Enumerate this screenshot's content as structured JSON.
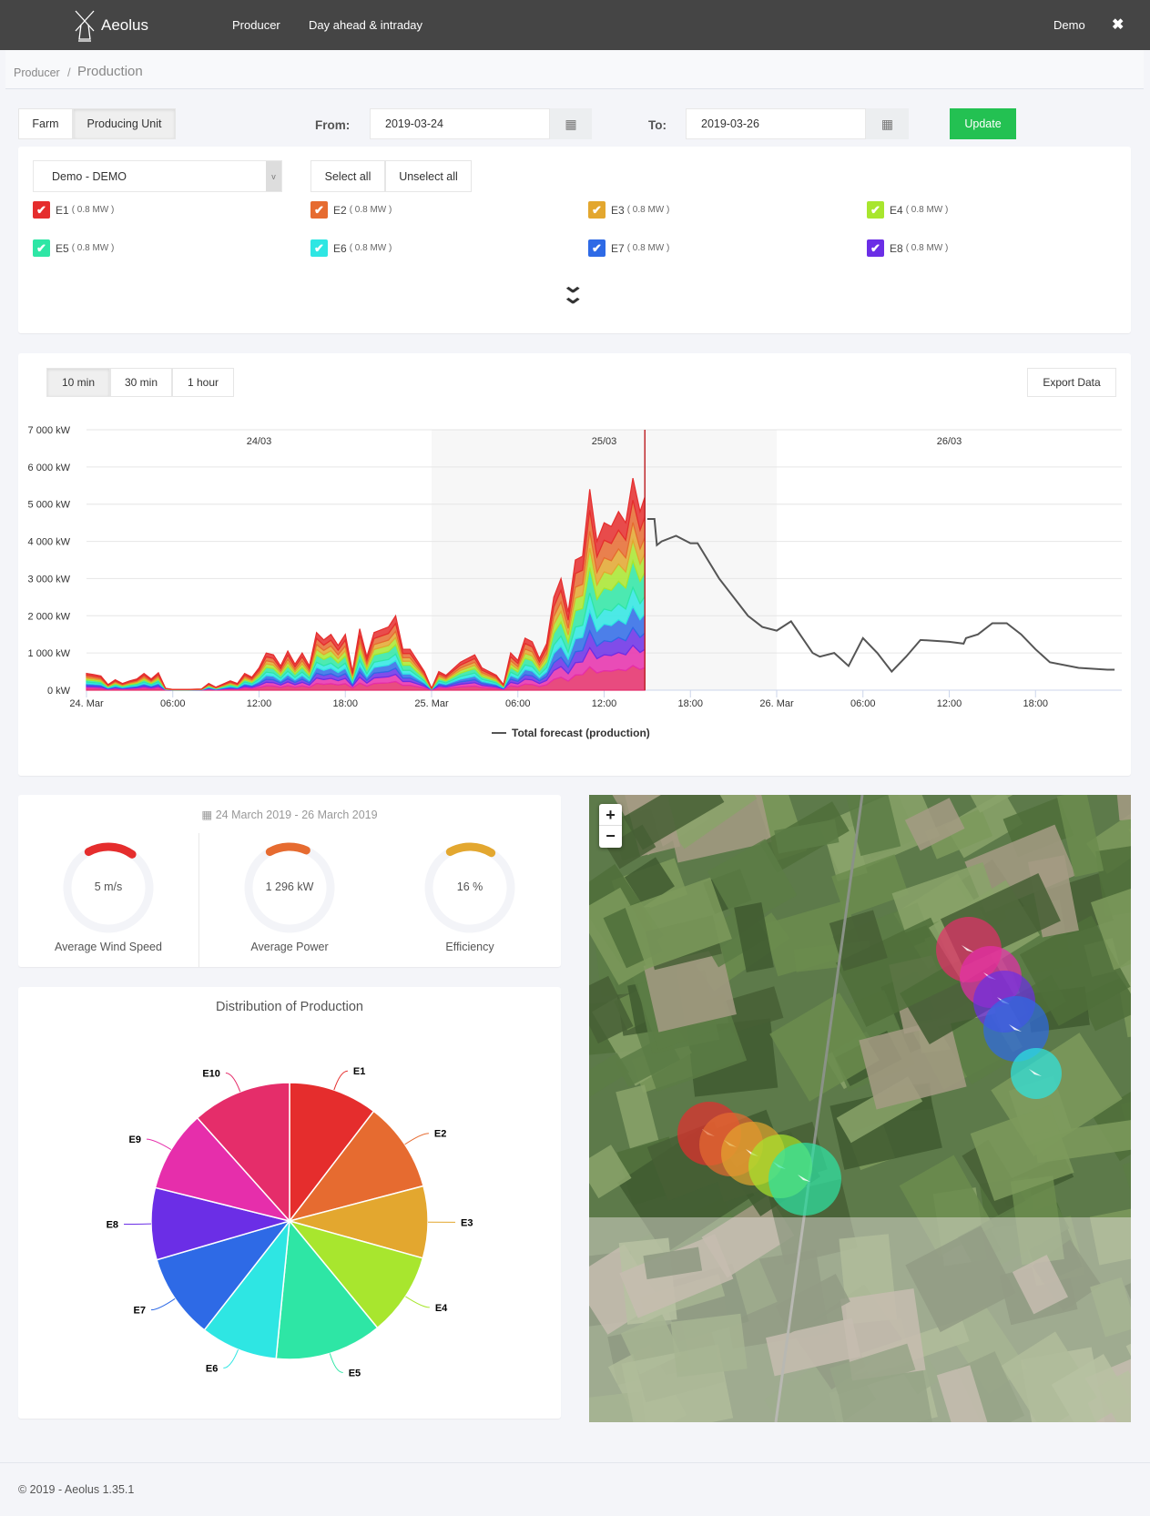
{
  "header": {
    "brand": "Aeolus",
    "nav": [
      "Producer",
      "Day ahead & intraday"
    ],
    "user": "Demo",
    "close_icon": "close-icon"
  },
  "breadcrumb": {
    "parent": "Producer",
    "separator": "/",
    "current": "Production"
  },
  "toolbar": {
    "modes": [
      "Farm",
      "Producing Unit"
    ],
    "active_mode": "Producing Unit",
    "from_label": "From:",
    "from_value": "2019-03-24",
    "to_label": "To:",
    "to_value": "2019-03-26",
    "update_label": "Update"
  },
  "selector": {
    "farm_value": "Demo - DEMO",
    "select_all": "Select all",
    "unselect_all": "Unselect all",
    "units": [
      {
        "name": "E1",
        "cap": "( 0.8 MW )",
        "color": "#e52d2d",
        "checked": true
      },
      {
        "name": "E2",
        "cap": "( 0.8 MW )",
        "color": "#e66b30",
        "checked": true
      },
      {
        "name": "E3",
        "cap": "( 0.8 MW )",
        "color": "#e3a72f",
        "checked": true
      },
      {
        "name": "E4",
        "cap": "( 0.8 MW )",
        "color": "#a8e62e",
        "checked": true
      },
      {
        "name": "E5",
        "cap": "( 0.8 MW )",
        "color": "#2ee6a5",
        "checked": true
      },
      {
        "name": "E6",
        "cap": "( 0.8 MW )",
        "color": "#2ee6e3",
        "checked": true
      },
      {
        "name": "E7",
        "cap": "( 0.8 MW )",
        "color": "#2e6ae6",
        "checked": true
      },
      {
        "name": "E8",
        "cap": "( 0.8 MW )",
        "color": "#6b2ee6",
        "checked": true
      }
    ]
  },
  "chart_controls": {
    "intervals": [
      "10 min",
      "30 min",
      "1 hour"
    ],
    "active": "10 min",
    "export_label": "Export Data"
  },
  "chart_data": [
    {
      "type": "area",
      "stacked": true,
      "yticks": [
        "0 kW",
        "1 000 kW",
        "2 000 kW",
        "3 000 kW",
        "4 000 kW",
        "5 000 kW",
        "6 000 kW",
        "7 000 kW"
      ],
      "ylim": [
        0,
        7000
      ],
      "xticks": [
        "24. Mar",
        "06:00",
        "12:00",
        "18:00",
        "25. Mar",
        "06:00",
        "12:00",
        "18:00",
        "26. Mar",
        "06:00",
        "12:00",
        "18:00"
      ],
      "xlim": [
        "2019-03-24 00:00",
        "2019-03-27 00:00"
      ],
      "day_labels": [
        "24/03",
        "25/03",
        "26/03"
      ],
      "highlighted_day": "2019-03-25",
      "now_marker": "2019-03-25 14:50",
      "grid": true,
      "legend": "bottom",
      "stack_order_bottom_to_top": [
        "E10",
        "E9",
        "E8",
        "E7",
        "E6",
        "E5",
        "E4",
        "E3",
        "E2",
        "E1"
      ],
      "actual_total": [
        [
          "2019-03-24 00:00",
          450
        ],
        [
          "2019-03-24 00:30",
          420
        ],
        [
          "2019-03-24 01:00",
          380
        ],
        [
          "2019-03-24 01:30",
          150
        ],
        [
          "2019-03-24 02:00",
          280
        ],
        [
          "2019-03-24 02:30",
          180
        ],
        [
          "2019-03-24 03:00",
          250
        ],
        [
          "2019-03-24 03:30",
          300
        ],
        [
          "2019-03-24 04:00",
          450
        ],
        [
          "2019-03-24 04:30",
          300
        ],
        [
          "2019-03-24 05:00",
          470
        ],
        [
          "2019-03-24 05:30",
          50
        ],
        [
          "2019-03-24 06:00",
          20
        ],
        [
          "2019-03-24 07:00",
          20
        ],
        [
          "2019-03-24 08:00",
          30
        ],
        [
          "2019-03-24 08:30",
          180
        ],
        [
          "2019-03-24 09:00",
          80
        ],
        [
          "2019-03-24 10:00",
          250
        ],
        [
          "2019-03-24 10:30",
          180
        ],
        [
          "2019-03-24 11:00",
          450
        ],
        [
          "2019-03-24 11:30",
          350
        ],
        [
          "2019-03-24 12:00",
          600
        ],
        [
          "2019-03-24 12:30",
          1000
        ],
        [
          "2019-03-24 13:00",
          950
        ],
        [
          "2019-03-24 13:30",
          650
        ],
        [
          "2019-03-24 14:00",
          1050
        ],
        [
          "2019-03-24 14:30",
          700
        ],
        [
          "2019-03-24 15:00",
          1000
        ],
        [
          "2019-03-24 15:30",
          650
        ],
        [
          "2019-03-24 16:00",
          1550
        ],
        [
          "2019-03-24 16:30",
          1350
        ],
        [
          "2019-03-24 17:00",
          1500
        ],
        [
          "2019-03-24 17:30",
          1200
        ],
        [
          "2019-03-24 18:00",
          1500
        ],
        [
          "2019-03-24 18:30",
          500
        ],
        [
          "2019-03-24 19:00",
          1650
        ],
        [
          "2019-03-24 19:30",
          900
        ],
        [
          "2019-03-24 20:00",
          1550
        ],
        [
          "2019-03-24 21:00",
          1700
        ],
        [
          "2019-03-24 21:30",
          2000
        ],
        [
          "2019-03-24 22:00",
          1100
        ],
        [
          "2019-03-24 22:30",
          1100
        ],
        [
          "2019-03-24 23:00",
          800
        ],
        [
          "2019-03-24 23:30",
          500
        ],
        [
          "2019-03-25 00:00",
          50
        ],
        [
          "2019-03-25 00:30",
          500
        ],
        [
          "2019-03-25 01:00",
          400
        ],
        [
          "2019-03-25 02:00",
          750
        ],
        [
          "2019-03-25 03:00",
          950
        ],
        [
          "2019-03-25 03:30",
          600
        ],
        [
          "2019-03-25 04:00",
          500
        ],
        [
          "2019-03-25 04:30",
          400
        ],
        [
          "2019-03-25 05:00",
          150
        ],
        [
          "2019-03-25 05:30",
          1000
        ],
        [
          "2019-03-25 06:00",
          800
        ],
        [
          "2019-03-25 06:30",
          1400
        ],
        [
          "2019-03-25 07:00",
          1300
        ],
        [
          "2019-03-25 07:30",
          850
        ],
        [
          "2019-03-25 08:00",
          1250
        ],
        [
          "2019-03-25 08:30",
          2500
        ],
        [
          "2019-03-25 09:00",
          3000
        ],
        [
          "2019-03-25 09:30",
          2100
        ],
        [
          "2019-03-25 10:00",
          3500
        ],
        [
          "2019-03-25 10:30",
          3600
        ],
        [
          "2019-03-25 11:00",
          5400
        ],
        [
          "2019-03-25 11:30",
          4000
        ],
        [
          "2019-03-25 12:00",
          4500
        ],
        [
          "2019-03-25 12:30",
          4400
        ],
        [
          "2019-03-25 13:00",
          4800
        ],
        [
          "2019-03-25 13:30",
          4500
        ],
        [
          "2019-03-25 14:00",
          5700
        ],
        [
          "2019-03-25 14:30",
          4800
        ],
        [
          "2019-03-25 14:50",
          5200
        ]
      ],
      "forecast": {
        "name": "Total forecast (production)",
        "color": "#555555",
        "points": [
          [
            "2019-03-25 15:00",
            4600
          ],
          [
            "2019-03-25 15:30",
            4600
          ],
          [
            "2019-03-25 15:40",
            3900
          ],
          [
            "2019-03-25 16:00",
            4000
          ],
          [
            "2019-03-25 17:00",
            4150
          ],
          [
            "2019-03-25 18:00",
            3950
          ],
          [
            "2019-03-25 18:30",
            3950
          ],
          [
            "2019-03-25 20:00",
            3000
          ],
          [
            "2019-03-25 22:00",
            2000
          ],
          [
            "2019-03-25 23:00",
            1700
          ],
          [
            "2019-03-26 00:00",
            1600
          ],
          [
            "2019-03-26 01:00",
            1850
          ],
          [
            "2019-03-26 02:30",
            1000
          ],
          [
            "2019-03-26 03:00",
            900
          ],
          [
            "2019-03-26 04:00",
            1000
          ],
          [
            "2019-03-26 05:00",
            650
          ],
          [
            "2019-03-26 06:00",
            1400
          ],
          [
            "2019-03-26 07:00",
            1000
          ],
          [
            "2019-03-26 08:00",
            500
          ],
          [
            "2019-03-26 09:00",
            900
          ],
          [
            "2019-03-26 10:00",
            1350
          ],
          [
            "2019-03-26 12:00",
            1300
          ],
          [
            "2019-03-26 13:00",
            1250
          ],
          [
            "2019-03-26 13:10",
            1400
          ],
          [
            "2019-03-26 14:00",
            1500
          ],
          [
            "2019-03-26 15:00",
            1800
          ],
          [
            "2019-03-26 16:00",
            1800
          ],
          [
            "2019-03-26 17:00",
            1500
          ],
          [
            "2019-03-26 18:00",
            1100
          ],
          [
            "2019-03-26 19:00",
            750
          ],
          [
            "2019-03-26 21:00",
            600
          ],
          [
            "2019-03-26 23:00",
            550
          ],
          [
            "2019-03-26 23:30",
            550
          ]
        ]
      }
    },
    {
      "type": "pie",
      "title": "Distribution of Production",
      "categories": [
        "E1",
        "E2",
        "E3",
        "E4",
        "E5",
        "E6",
        "E7",
        "E8",
        "E9",
        "E10"
      ],
      "values": [
        10.4,
        10.5,
        8.4,
        9.7,
        12.5,
        9.0,
        9.9,
        8.4,
        9.5,
        11.6
      ],
      "colors": [
        "#e52d2d",
        "#e66b30",
        "#e3a72f",
        "#a8e62e",
        "#2ee6a5",
        "#2ee6e3",
        "#2e6ae6",
        "#6b2ee6",
        "#e62eab",
        "#e52d6a"
      ]
    }
  ],
  "kpis": {
    "date_range": "24 March 2019 - 26 March 2019",
    "calendar_icon": "calendar-icon",
    "items": [
      {
        "value": "5 m/s",
        "label": "Average Wind Speed",
        "color": "#e52d2d",
        "fraction": 0.17
      },
      {
        "value": "1 296 kW",
        "label": "Average Power",
        "color": "#e66b30",
        "fraction": 0.14
      },
      {
        "value": "16 %",
        "label": "Efficiency",
        "color": "#e3a72f",
        "fraction": 0.16
      }
    ]
  },
  "map": {
    "zoom_in": "+",
    "zoom_out": "−",
    "turbines": [
      "E10",
      "E9",
      "E8",
      "E7",
      "E6",
      "E1",
      "E2",
      "E3",
      "E4",
      "E5"
    ]
  },
  "footer": {
    "text": "© 2019 - Aeolus 1.35.1"
  }
}
